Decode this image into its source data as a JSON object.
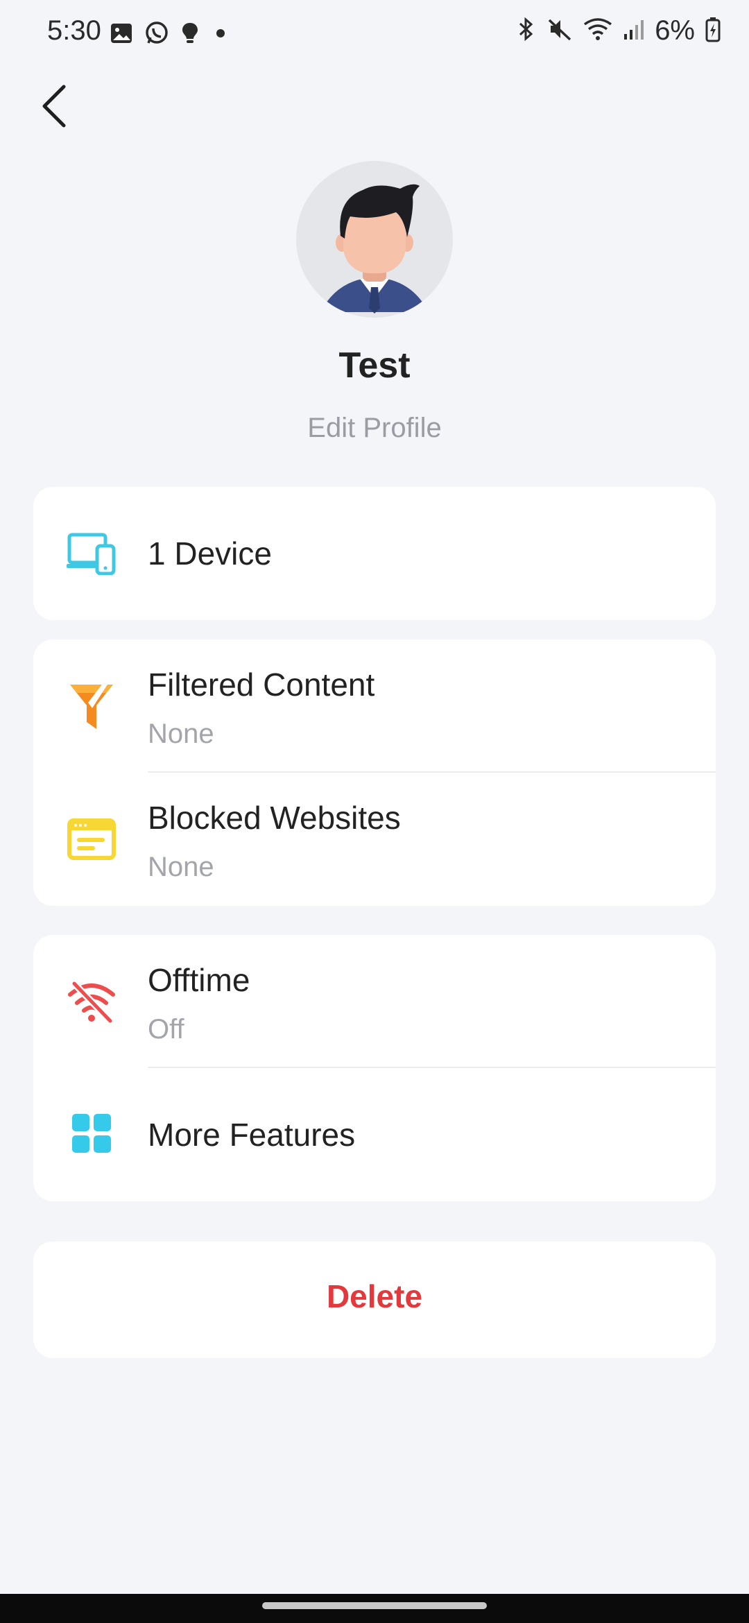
{
  "status_bar": {
    "time": "5:30",
    "battery_percent": "6%",
    "left_icons": [
      "gallery-icon",
      "whatsapp-icon",
      "bulb-icon",
      "dot-icon"
    ],
    "right_icons": [
      "bluetooth-icon",
      "mute-icon",
      "wifi-icon",
      "signal-icon",
      "battery-icon"
    ]
  },
  "profile": {
    "name": "Test",
    "edit_label": "Edit Profile"
  },
  "devices": {
    "label": "1 Device",
    "icon": "devices-icon",
    "icon_color": "#3fc8e4"
  },
  "content_card": {
    "filtered": {
      "title": "Filtered Content",
      "value": "None",
      "icon": "filter-icon",
      "icon_color": "#f58a1f"
    },
    "blocked": {
      "title": "Blocked Websites",
      "value": "None",
      "icon": "browser-icon",
      "icon_color": "#f7d733"
    }
  },
  "features_card": {
    "offtime": {
      "title": "Offtime",
      "value": "Off",
      "icon": "wifi-off-icon",
      "icon_color": "#ee4d4d"
    },
    "more": {
      "title": "More Features",
      "icon": "grid-icon",
      "icon_color": "#35c9ea"
    }
  },
  "delete": {
    "label": "Delete",
    "color": "#e4393c"
  }
}
